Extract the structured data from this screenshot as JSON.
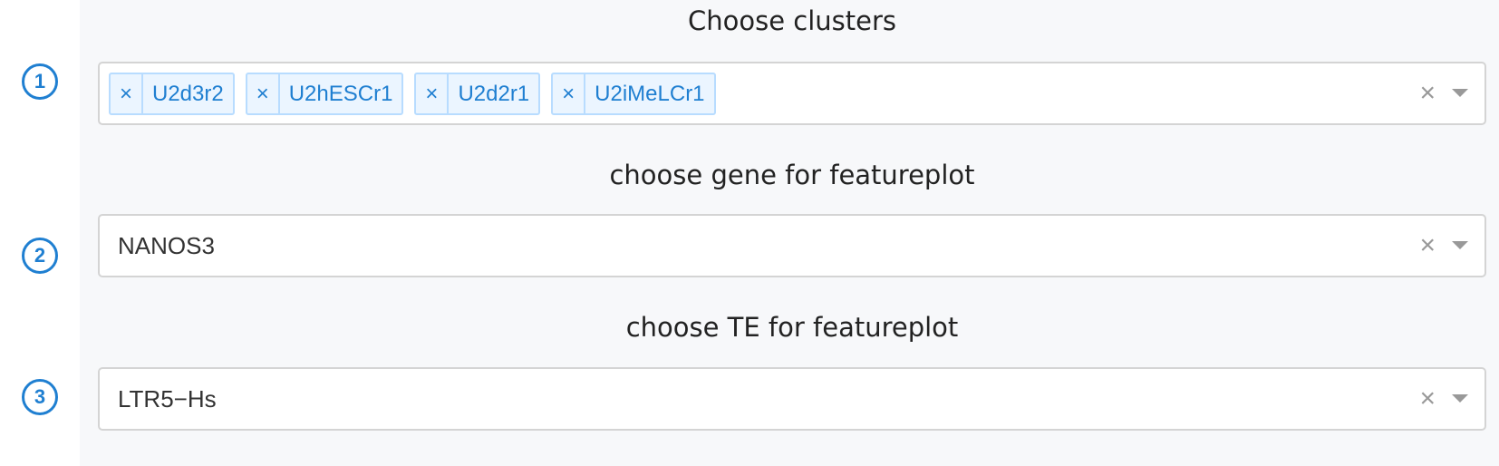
{
  "steps": [
    "1",
    "2",
    "3"
  ],
  "clusters": {
    "label": "Choose clusters",
    "tags": [
      {
        "remove": "×",
        "label": "U2d3r2"
      },
      {
        "remove": "×",
        "label": "U2hESCr1"
      },
      {
        "remove": "×",
        "label": "U2d2r1"
      },
      {
        "remove": "×",
        "label": "U2iMeLCr1"
      }
    ],
    "clear": "×"
  },
  "gene": {
    "label": "choose gene for featureplot",
    "value": "NANOS3",
    "clear": "×"
  },
  "te": {
    "label": "choose TE for featureplot",
    "value": "LTR5−Hs",
    "clear": "×"
  },
  "colors": {
    "accent": "#1f7fd1",
    "tag_background": "#ebf5ff",
    "tag_border": "#b8dcff",
    "panel_background": "#f7f8fa"
  }
}
